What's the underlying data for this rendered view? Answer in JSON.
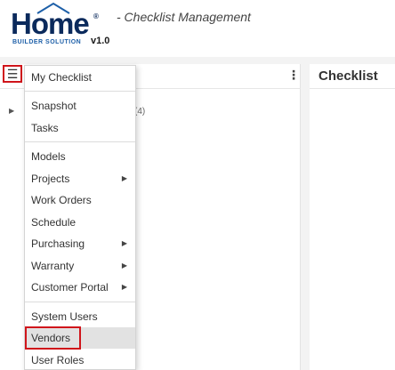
{
  "header": {
    "logo_word": "Home",
    "logo_reg": "®",
    "logo_sub": "BUILDER SOLUTION",
    "version": "v1.0",
    "subtitle": "- Checklist Management"
  },
  "left_panel": {
    "menu_icon": "hamburger-icon",
    "more_icon": "kebab-icon",
    "tree_count": "(4)"
  },
  "right_panel": {
    "title": "Checklist"
  },
  "menu": {
    "items": [
      {
        "label": "My Checklist",
        "submenu": false
      },
      {
        "label": "Snapshot",
        "submenu": false
      },
      {
        "label": "Tasks",
        "submenu": false
      },
      {
        "label": "Models",
        "submenu": false
      },
      {
        "label": "Projects",
        "submenu": true
      },
      {
        "label": "Work Orders",
        "submenu": false
      },
      {
        "label": "Schedule",
        "submenu": false
      },
      {
        "label": "Purchasing",
        "submenu": true
      },
      {
        "label": "Warranty",
        "submenu": true
      },
      {
        "label": "Customer Portal",
        "submenu": true
      },
      {
        "label": "System Users",
        "submenu": false
      },
      {
        "label": "Vendors",
        "submenu": false
      },
      {
        "label": "User Roles",
        "submenu": false
      }
    ],
    "arrow": "▶"
  },
  "colors": {
    "accent_red": "#d0151b",
    "logo_navy": "#0b2a5c",
    "logo_blue": "#1d5fa8"
  }
}
